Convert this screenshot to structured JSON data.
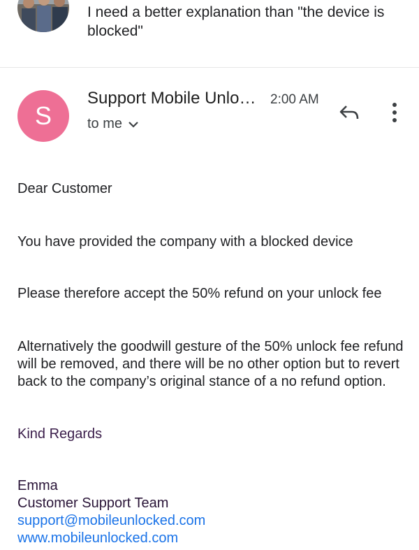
{
  "previous_message": {
    "snippet": "I need a better explanation than \"the device is blocked\""
  },
  "email": {
    "sender_initial": "S",
    "sender": "Support Mobile Unlo…",
    "time": "2:00 AM",
    "recipient": "to me",
    "body": {
      "greeting": "Dear Customer",
      "paragraph1": "You have provided the company with a blocked device",
      "paragraph2": "Please therefore accept the 50% refund on your unlock fee",
      "paragraph3": "Alternatively the goodwill gesture of the 50% unlock fee refund will be removed, and there will be no other option but to revert back to the company’s original stance of a no refund option.",
      "closing": "Kind Regards"
    },
    "signature": {
      "name": "Emma",
      "team": "Customer Support Team",
      "email": "support@mobileunlocked.com",
      "website": "www.mobileunlocked.com"
    }
  },
  "colors": {
    "avatar": "#ee6f95",
    "link": "#1a73e8"
  },
  "icons": [
    "reply-icon",
    "more-vert-icon",
    "chevron-down-icon"
  ]
}
